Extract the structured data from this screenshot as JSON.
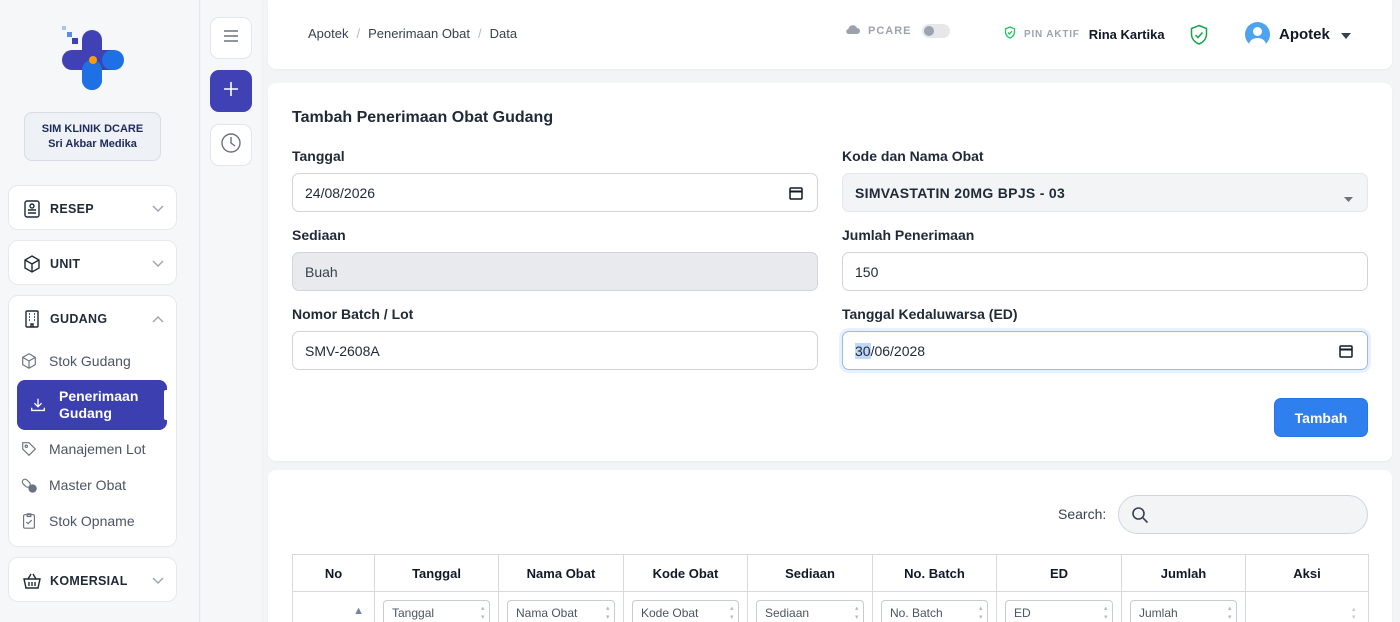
{
  "sidebar": {
    "clinic_line1": "SIM KLINIK DCARE",
    "clinic_line2": "Sri Akbar Medika",
    "menu": {
      "resep": "RESEP",
      "unit": "UNIT",
      "gudang": "GUDANG",
      "komersial": "KOMERSIAL"
    },
    "gudang_items": {
      "stok_gudang": "Stok Gudang",
      "penerimaan_l1": "Penerimaan",
      "penerimaan_l2": "Gudang",
      "manajemen_lot": "Manajemen Lot",
      "master_obat": "Master Obat",
      "stok_opname": "Stok Opname"
    }
  },
  "header": {
    "breadcrumb": [
      "Apotek",
      "Penerimaan Obat",
      "Data"
    ],
    "pcare_label": "PCARE",
    "pin_label": "PIN AKTIF",
    "pin_name": "Rina Kartika",
    "user_name": "Apotek"
  },
  "form": {
    "title": "Tambah Penerimaan Obat Gudang",
    "tanggal_label": "Tanggal",
    "tanggal_value": "24/08/2026",
    "kode_label": "Kode dan Nama Obat",
    "kode_value": "SIMVASTATIN 20MG BPJS - 03",
    "sediaan_label": "Sediaan",
    "sediaan_value": "Buah",
    "jumlah_label": "Jumlah Penerimaan",
    "jumlah_value": "150",
    "batch_label": "Nomor Batch / Lot",
    "batch_value": "SMV-2608A",
    "ed_label": "Tanggal Kedaluwarsa (ED)",
    "ed_value_day": "30",
    "ed_value_rest": "/06/2028",
    "add_button": "Tambah"
  },
  "table": {
    "search_label": "Search:",
    "columns": [
      "No",
      "Tanggal",
      "Nama Obat",
      "Kode Obat",
      "Sediaan",
      "No. Batch",
      "ED",
      "Jumlah",
      "Aksi"
    ],
    "filters": [
      "Tanggal",
      "Nama Obat",
      "Kode Obat",
      "Sediaan",
      "No. Batch",
      "ED",
      "Jumlah"
    ]
  },
  "colors": {
    "primary": "#3f41b5",
    "button_blue": "#2f7fee",
    "brand_blue": "#1f6fe5"
  }
}
